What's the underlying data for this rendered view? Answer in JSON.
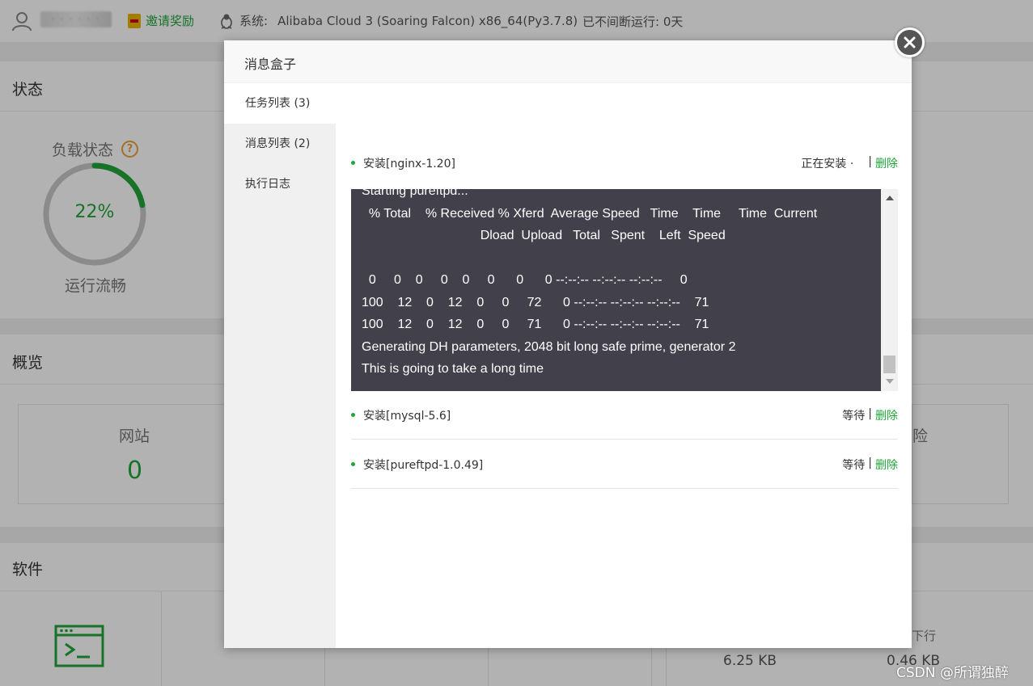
{
  "topbar": {
    "username": "· · · · ·  ·",
    "invite_label": "邀请奖励",
    "system_label": "系统:",
    "system_value": "Alibaba Cloud 3 (Soaring Falcon) x86_64(Py3.7.8)",
    "uptime": "已不间断运行: 0天"
  },
  "status": {
    "title": "状态",
    "load_label": "负载状态",
    "help": "?",
    "load_value": "22%",
    "load_fraction": 0.22,
    "load_state": "运行流畅"
  },
  "overview": {
    "title": "概览",
    "site_label": "网站",
    "site_value": "0",
    "right_partial_label": "险"
  },
  "software": {
    "title": "软件",
    "net_partial_label": "下行",
    "net_up": "6.25 KB",
    "net_down": "0.46 KB"
  },
  "modal": {
    "title": "消息盒子",
    "sidebar": [
      {
        "label": "任务列表 (3)",
        "active": true
      },
      {
        "label": "消息列表 (2)",
        "active": false
      },
      {
        "label": "执行日志",
        "active": false
      }
    ],
    "tasks": [
      {
        "name": "安装[nginx-1.20]",
        "status": "正在安装 ·",
        "sep": "|",
        "delete": "删除"
      },
      {
        "name": "安装[mysql-5.6]",
        "status": "等待",
        "sep": "|",
        "delete": "删除"
      },
      {
        "name": "安装[pureftpd-1.0.49]",
        "status": "等待",
        "sep": "|",
        "delete": "删除"
      }
    ],
    "console_lines": [
      "Starting pureftpd...",
      "  % Total    % Received % Xferd  Average Speed   Time    Time     Time  Current",
      "                                 Dload  Upload   Total   Spent    Left  Speed",
      "",
      "  0     0    0     0    0     0      0      0 --:--:-- --:--:-- --:--:--     0",
      "100    12    0    12    0     0     72      0 --:--:-- --:--:-- --:--:--    71",
      "100    12    0    12    0     0     71      0 --:--:-- --:--:-- --:--:--    71",
      "Generating DH parameters, 2048 bit long safe prime, generator 2",
      "This is going to take a long time"
    ]
  },
  "watermark": "CSDN @所谓独醉",
  "colors": {
    "accent": "#20a53a",
    "console_bg": "#41404b",
    "help": "#e8a13a"
  }
}
